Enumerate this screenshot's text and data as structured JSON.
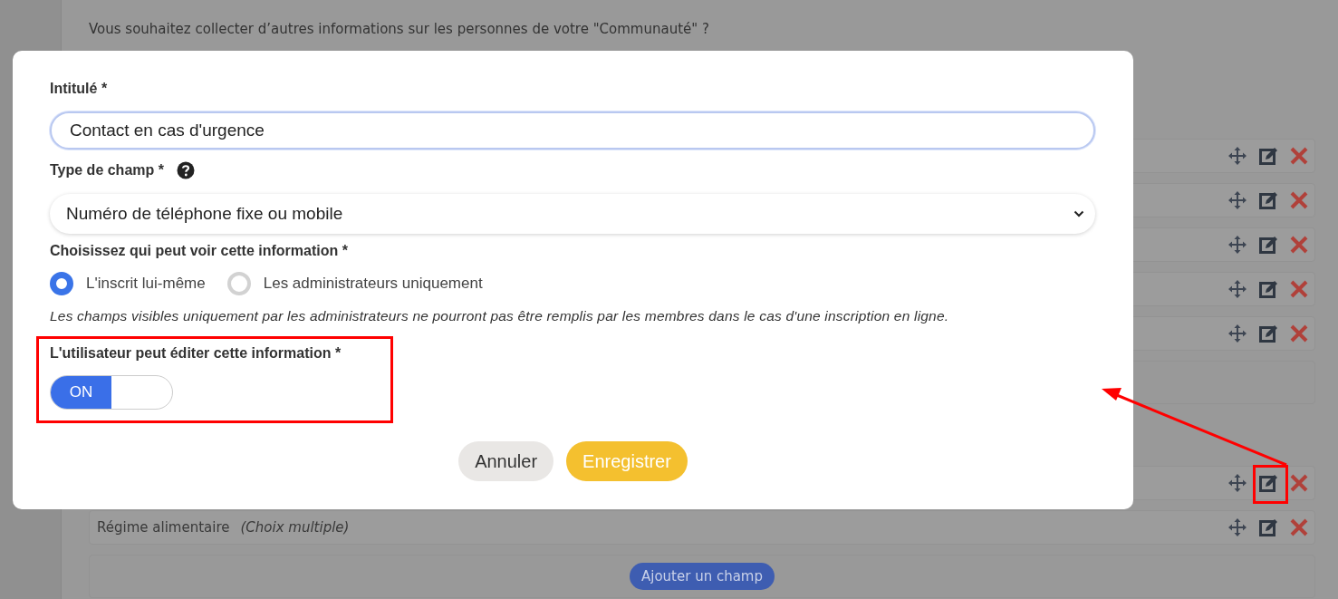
{
  "page": {
    "intro": "Vous souhaitez collecter d’autres informations sur les personnes de votre \"Communauté\" ?",
    "field_groups": [
      {
        "fields": [
          {
            "kind": "row"
          },
          {
            "kind": "row"
          },
          {
            "kind": "row"
          },
          {
            "kind": "row"
          },
          {
            "kind": "row"
          }
        ],
        "add_panel": {
          "kind": "empty"
        }
      },
      {
        "fields": [
          {
            "kind": "row"
          },
          {
            "kind": "row",
            "label": "Régime alimentaire",
            "type": "(Choix multiple)"
          }
        ],
        "add_panel": {
          "kind": "with_button",
          "button": "Ajouter un champ"
        }
      }
    ]
  },
  "dialog": {
    "title_field": {
      "label": "Intitulé *",
      "value": "Contact en cas d'urgence",
      "focused": true
    },
    "type_field": {
      "label": "Type de champ *",
      "value": "Numéro de téléphone fixe ou mobile"
    },
    "visibility": {
      "label": "Choisissez qui peut voir cette information *",
      "options": [
        {
          "label": "L'inscrit lui-même",
          "selected": true
        },
        {
          "label": "Les administrateurs uniquement",
          "selected": false
        }
      ],
      "note": "Les champs visibles uniquement par les administrateurs ne pourront pas être remplis par les membres dans le cas d'une inscription en ligne."
    },
    "editable": {
      "label": "L'utilisateur peut éditer cette information *",
      "on": true,
      "on_label": "ON"
    },
    "buttons": [
      {
        "label": "Annuler",
        "kind": "secondary"
      },
      {
        "label": "Enregistrer",
        "kind": "primary"
      }
    ]
  }
}
